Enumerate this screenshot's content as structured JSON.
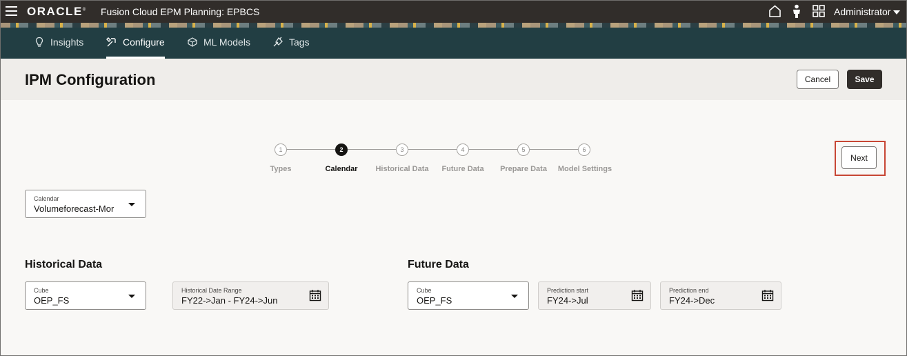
{
  "topbar": {
    "brand": "ORACLE",
    "app_title": "Fusion Cloud EPM Planning:  EPBCS",
    "user_label": "Administrator",
    "icons": [
      "hamburger-icon",
      "home-icon",
      "person-icon",
      "grid-icon"
    ]
  },
  "nav": {
    "items": [
      {
        "label": "Insights",
        "icon": "insights-icon",
        "active": false
      },
      {
        "label": "Configure",
        "icon": "configure-icon",
        "active": true
      },
      {
        "label": "ML Models",
        "icon": "ml-models-icon",
        "active": false
      },
      {
        "label": "Tags",
        "icon": "tags-icon",
        "active": false
      }
    ]
  },
  "header": {
    "title": "IPM Configuration",
    "cancel_label": "Cancel",
    "save_label": "Save"
  },
  "stepper": {
    "current_step": 2,
    "steps": [
      {
        "number": "1",
        "label": "Types"
      },
      {
        "number": "2",
        "label": "Calendar"
      },
      {
        "number": "3",
        "label": "Historical Data"
      },
      {
        "number": "4",
        "label": "Future Data"
      },
      {
        "number": "5",
        "label": "Prepare Data"
      },
      {
        "number": "6",
        "label": "Model Settings"
      }
    ],
    "next_label": "Next"
  },
  "calendar": {
    "label": "Calendar",
    "value": "Volumeforecast-Mor"
  },
  "historical": {
    "title": "Historical Data",
    "cube_label": "Cube",
    "cube_value": "OEP_FS",
    "range_label": "Historical Date Range",
    "range_value": "FY22->Jan - FY24->Jun"
  },
  "future": {
    "title": "Future Data",
    "cube_label": "Cube",
    "cube_value": "OEP_FS",
    "start_label": "Prediction start",
    "start_value": "FY24->Jul",
    "end_label": "Prediction end",
    "end_value": "FY24->Dec"
  },
  "colors": {
    "topbar": "#312d2a",
    "nav": "#223e43",
    "highlight": "#c74634"
  }
}
